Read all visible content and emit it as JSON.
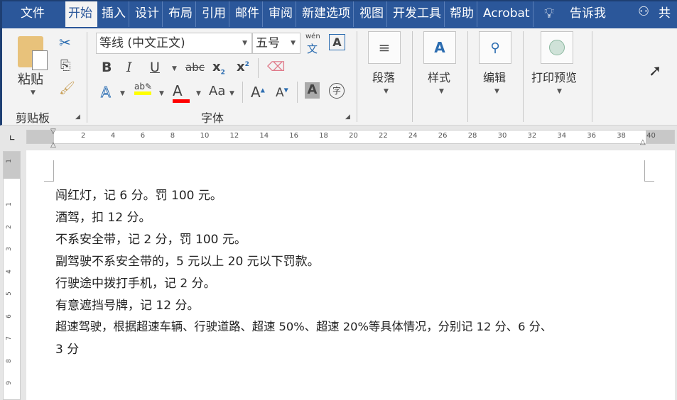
{
  "tabs": [
    "文件",
    "开始",
    "插入",
    "设计",
    "布局",
    "引用",
    "邮件",
    "审阅",
    "新建选项",
    "视图",
    "开发工具",
    "帮助",
    "Acrobat"
  ],
  "tell_me": "告诉我",
  "share": "共享",
  "clipboard": {
    "paste": "粘贴",
    "group": "剪贴板"
  },
  "font": {
    "name": "等线 (中文正文)",
    "size": "五号",
    "group": "字体",
    "phonetic_top": "wén",
    "phonetic_bottom": "文",
    "change_case": "Aa",
    "enclose": "字"
  },
  "big_buttons": {
    "paragraph": "段落",
    "styles": "样式",
    "editing": "编辑",
    "print_preview": "打印预览"
  },
  "ruler": {
    "labels": [
      "2",
      "4",
      "6",
      "8",
      "10",
      "12",
      "14",
      "16",
      "18",
      "20",
      "22",
      "24",
      "26",
      "28",
      "30",
      "32",
      "34",
      "36",
      "38",
      "40"
    ]
  },
  "vruler": {
    "labels": [
      "1",
      "1",
      "2",
      "3",
      "4",
      "5",
      "6",
      "7",
      "8",
      "9"
    ]
  },
  "colors": {
    "highlight": "#ffff00",
    "font_color": "#ff0000",
    "accent": "#2b579a"
  },
  "document": {
    "lines": [
      "闯红灯，记 6 分。罚 100 元。",
      "酒驾，扣 12 分。",
      "不系安全带，记 2 分，罚 100 元。",
      "副驾驶不系安全带的，5 元以上 20 元以下罚款。",
      "行驶途中拨打手机，记 2 分。",
      "有意遮挡号牌，记 12 分。",
      "超速驾驶，根据超速车辆、行驶道路、超速 50%、超速 20%等具体情况，分别记 12 分、6 分、",
      "3 分"
    ]
  }
}
